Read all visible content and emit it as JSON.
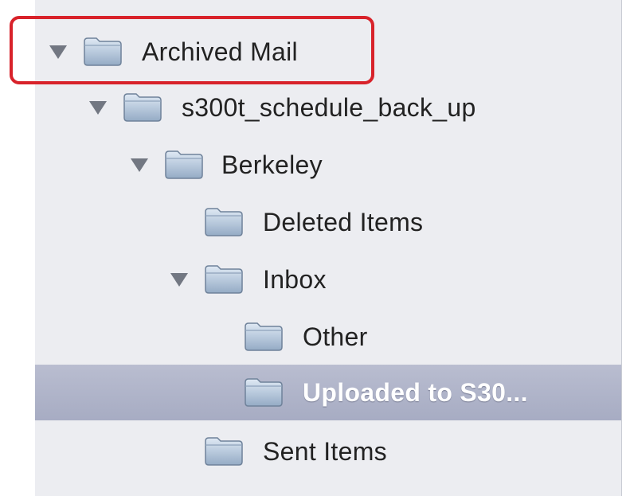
{
  "folders": [
    {
      "label": "Archived Mail",
      "expanded": true
    },
    {
      "label": "s300t_schedule_back_up",
      "expanded": true
    },
    {
      "label": "Berkeley",
      "expanded": true
    },
    {
      "label": "Deleted Items"
    },
    {
      "label": "Inbox",
      "expanded": true
    },
    {
      "label": "Other"
    },
    {
      "label": "Uploaded to S30...",
      "selected": true
    },
    {
      "label": "Sent Items"
    }
  ],
  "colors": {
    "highlight": "#d8222a",
    "selection": "#a7acc3"
  },
  "icons": {
    "folder": "folder-icon",
    "disclosure": "disclosure-triangle-icon"
  }
}
